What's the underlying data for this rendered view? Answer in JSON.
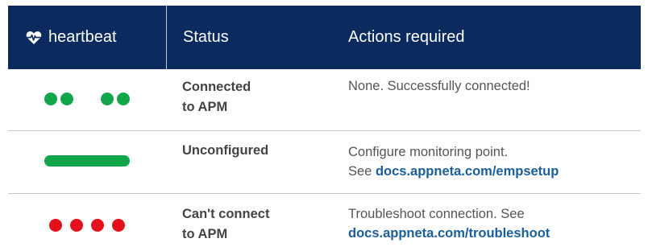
{
  "header": {
    "brand_label": "heartbeat",
    "status_label": "Status",
    "actions_label": "Actions required"
  },
  "rows": [
    {
      "indicator": "green-double-blink",
      "status_line1": "Connected",
      "status_line2": "to  APM",
      "action_line1": "None. Successfully connected!",
      "action_prefix": "",
      "action_link": ""
    },
    {
      "indicator": "green-solid-bar",
      "status_line1": "Unconfigured",
      "status_line2": "",
      "action_line1": "Configure monitoring point.",
      "action_prefix": "See ",
      "action_link": "docs.appneta.com/empsetup"
    },
    {
      "indicator": "red-four-dots",
      "status_line1": "Can't connect",
      "status_line2": "to APM",
      "action_line1": "Troubleshoot connection. See",
      "action_prefix": "",
      "action_link": "docs.appneta.com/troubleshoot"
    }
  ],
  "colors": {
    "header_bg": "#0b2b5e",
    "green": "#12a64a",
    "red": "#e3111b",
    "link": "#1a5e9a"
  },
  "icons": {
    "brand": "heart-pulse-icon"
  }
}
